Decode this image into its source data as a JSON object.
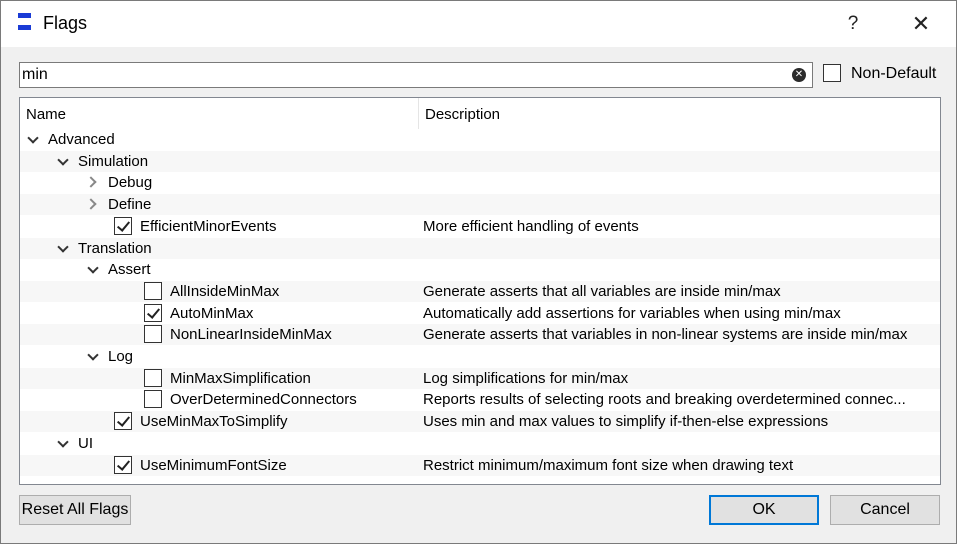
{
  "window": {
    "title": "Flags",
    "help_label": "?",
    "close_label": "✕"
  },
  "search": {
    "value": "min",
    "placeholder": ""
  },
  "non_default": {
    "label": "Non-Default",
    "checked": false
  },
  "tree": {
    "columns": [
      "Name",
      "Description"
    ],
    "rows": [
      {
        "label": "Advanced",
        "desc": "",
        "level": 0,
        "type": "expanded"
      },
      {
        "label": "Simulation",
        "desc": "",
        "level": 1,
        "type": "expanded"
      },
      {
        "label": "Debug",
        "desc": "",
        "level": 2,
        "type": "collapsed"
      },
      {
        "label": "Define",
        "desc": "",
        "level": 2,
        "type": "collapsed"
      },
      {
        "label": "EfficientMinorEvents",
        "desc": "More efficient handling of events",
        "level": 2,
        "type": "checkbox",
        "checked": true
      },
      {
        "label": "Translation",
        "desc": "",
        "level": 1,
        "type": "expanded"
      },
      {
        "label": "Assert",
        "desc": "",
        "level": 2,
        "type": "expanded"
      },
      {
        "label": "AllInsideMinMax",
        "desc": "Generate asserts that all variables are inside min/max",
        "level": 3,
        "type": "checkbox",
        "checked": false
      },
      {
        "label": "AutoMinMax",
        "desc": "Automatically add assertions for variables when using min/max",
        "level": 3,
        "type": "checkbox",
        "checked": true
      },
      {
        "label": "NonLinearInsideMinMax",
        "desc": "Generate asserts that variables in non-linear systems are inside min/max",
        "level": 3,
        "type": "checkbox",
        "checked": false
      },
      {
        "label": "Log",
        "desc": "",
        "level": 2,
        "type": "expanded"
      },
      {
        "label": "MinMaxSimplification",
        "desc": "Log simplifications for min/max",
        "level": 3,
        "type": "checkbox",
        "checked": false
      },
      {
        "label": "OverDeterminedConnectors",
        "desc": "Reports results of selecting roots and breaking overdetermined connec...",
        "level": 3,
        "type": "checkbox",
        "checked": false
      },
      {
        "label": "UseMinMaxToSimplify",
        "desc": "Uses min and max values to simplify if-then-else expressions",
        "level": 2,
        "type": "checkbox",
        "checked": true
      },
      {
        "label": "UI",
        "desc": "",
        "level": 1,
        "type": "expanded"
      },
      {
        "label": "UseMinimumFontSize",
        "desc": "Restrict minimum/maximum font size when drawing text",
        "level": 2,
        "type": "checkbox",
        "checked": true
      }
    ]
  },
  "buttons": {
    "reset": "Reset All Flags",
    "ok": "OK",
    "cancel": "Cancel"
  },
  "colors": {
    "accent": "#0078d7",
    "app_icon": "#1a3bd6"
  }
}
